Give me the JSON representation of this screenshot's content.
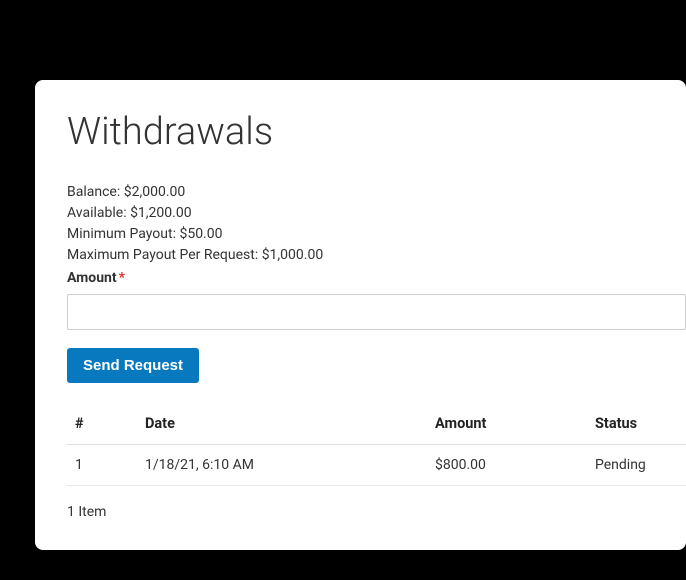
{
  "title": "Withdrawals",
  "info": {
    "balance_label": "Balance: ",
    "balance_value": "$2,000.00",
    "available_label": "Available: ",
    "available_value": "$1,200.00",
    "min_payout_label": "Minimum Payout: ",
    "min_payout_value": "$50.00",
    "max_payout_label": "Maximum Payout Per Request: ",
    "max_payout_value": "$1,000.00"
  },
  "form": {
    "amount_label": "Amount",
    "required_mark": "*",
    "amount_value": "",
    "send_button": "Send Request"
  },
  "table": {
    "headers": {
      "num": "#",
      "date": "Date",
      "amount": "Amount",
      "status": "Status"
    },
    "rows": [
      {
        "num": "1",
        "date": "1/18/21, 6:10 AM",
        "amount": "$800.00",
        "status": "Pending"
      }
    ]
  },
  "footer": {
    "item_count": "1 Item"
  }
}
